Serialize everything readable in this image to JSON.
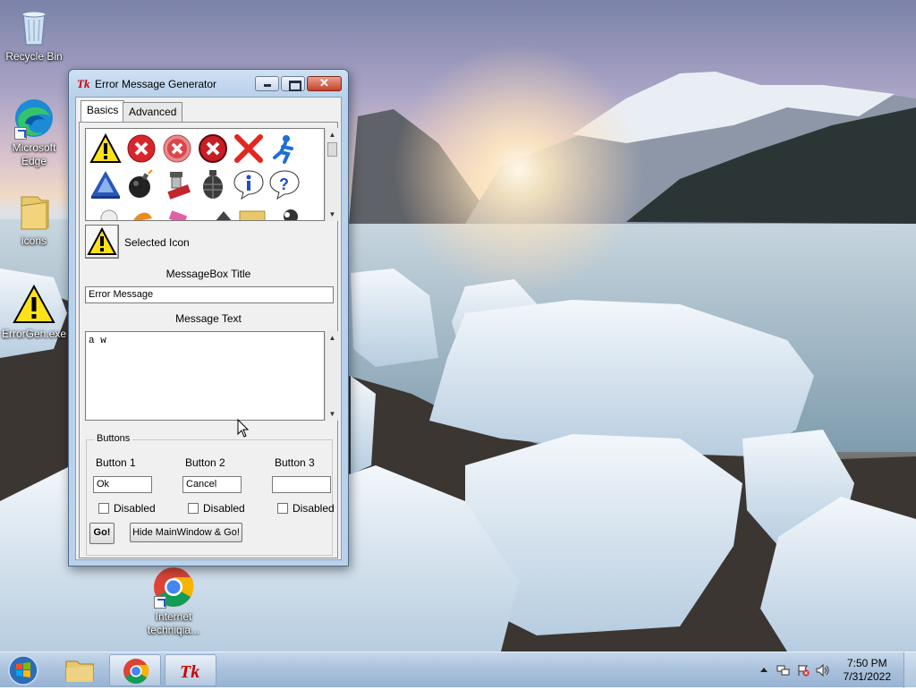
{
  "desktop": {
    "icons": [
      {
        "label": "Recycle Bin",
        "icon": "recycle-bin-icon"
      },
      {
        "label": "Microsoft Edge",
        "icon": "edge-icon"
      },
      {
        "label": "icons",
        "icon": "folder-icon"
      },
      {
        "label": "ErrorGen.exe",
        "icon": "warning-icon"
      },
      {
        "label": "Internet techniqia...",
        "icon": "chrome-icon"
      }
    ]
  },
  "window": {
    "title": "Error Message Generator",
    "title_icon": "Tk",
    "tabs": [
      {
        "label": "Basics",
        "active": true
      },
      {
        "label": "Advanced",
        "active": false
      }
    ],
    "icon_gallery": [
      "warning-icon",
      "error-red-circle-icon",
      "error-faded-circle-icon",
      "error-dark-circle-icon",
      "red-x-icon",
      "running-man-icon",
      "triangle-a-icon",
      "bomb-icon",
      "fire-extinguisher-icon",
      "grenade-icon",
      "info-icon",
      "question-icon"
    ],
    "selected_icon_label": "Selected Icon",
    "messagebox_title_label": "MessageBox Title",
    "messagebox_title_value": "Error Message",
    "message_text_label": "Message Text",
    "message_text_value": "a w",
    "buttons_group": {
      "title": "Buttons",
      "button1": {
        "label": "Button 1",
        "value": "Ok",
        "disabled_label": "Disabled"
      },
      "button2": {
        "label": "Button 2",
        "value": "Cancel",
        "disabled_label": "Disabled"
      },
      "button3": {
        "label": "Button 3",
        "value": "",
        "disabled_label": "Disabled"
      }
    },
    "go_label": "Go!",
    "hide_go_label": "Hide MainWindow & Go!"
  },
  "taskbar": {
    "time": "7:50 PM",
    "date": "7/31/2022",
    "apps": [
      "file-explorer-icon",
      "chrome-icon",
      "tk-app-icon"
    ]
  },
  "colors": {
    "titlebar": "#b9d1ea",
    "taskbar": "#a9c1dc",
    "error_red": "#d9262c"
  }
}
